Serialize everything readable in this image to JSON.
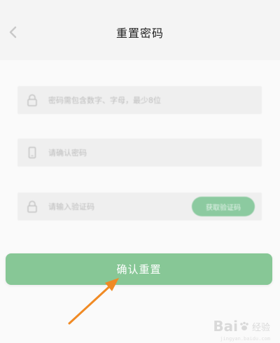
{
  "header": {
    "title": "重置密码",
    "back_icon": "chevron-left-icon"
  },
  "form": {
    "new_password": {
      "placeholder": "密码需包含数字、字母，最少8位",
      "icon": "lock-icon"
    },
    "confirm_password": {
      "placeholder": "请确认密码",
      "icon": "phone-icon"
    },
    "verification_code": {
      "placeholder": "请输入验证码",
      "icon": "lock-icon",
      "button_label": "获取验证码"
    },
    "submit_label": "确认重置"
  },
  "annotation": {
    "color": "#f08a24",
    "icon": "arrow-icon"
  },
  "watermark": {
    "logo": "Bai",
    "text": "经验",
    "sub": "jingyan.baidu.com"
  }
}
